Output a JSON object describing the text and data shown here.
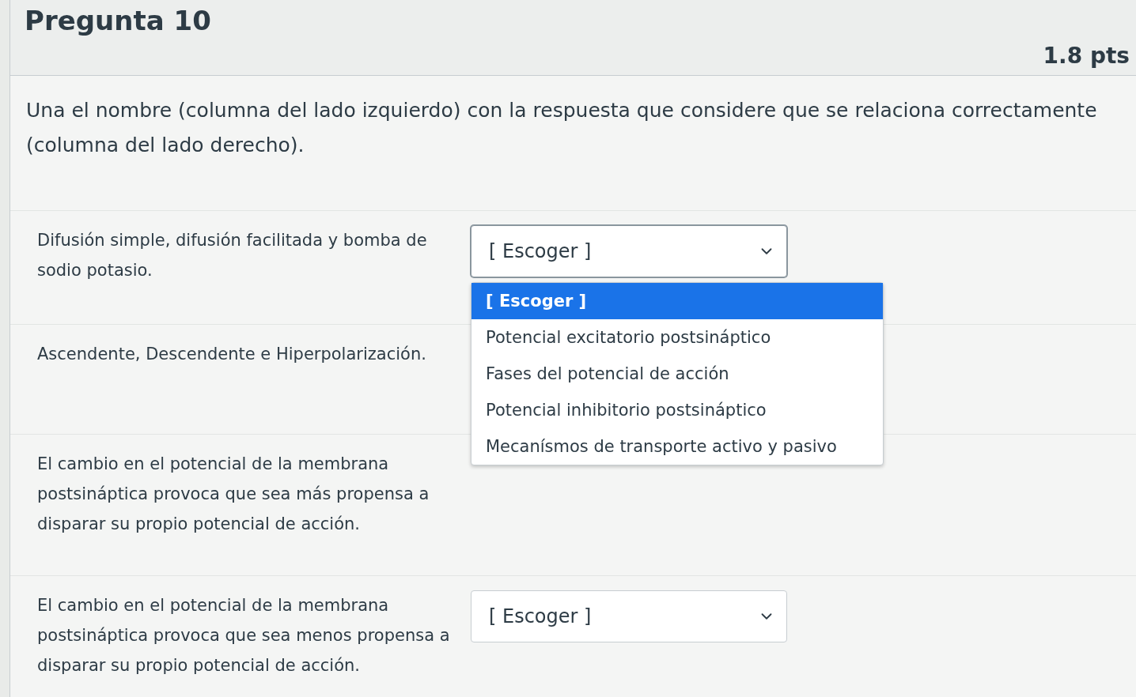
{
  "question": {
    "title": "Pregunta 10",
    "points": "1.8 pts"
  },
  "prompt": "Una el nombre (columna del lado izquierdo) con la respuesta que considere que se relaciona correctamente (columna del lado derecho).",
  "matches": [
    {
      "text": "Difusión simple, difusión facilitada y bomba de sodio potasio.",
      "select": {
        "value": "[ Escoger ]",
        "expanded": true,
        "options": [
          {
            "label": "[ Escoger ]",
            "selected": true
          },
          {
            "label": "Potencial excitatorio postsináptico",
            "selected": false
          },
          {
            "label": "Fases del potencial de acción",
            "selected": false
          },
          {
            "label": "Potencial inhibitorio postsináptico",
            "selected": false
          },
          {
            "label": "Mecanísmos de transporte activo y pasivo",
            "selected": false
          }
        ]
      }
    },
    {
      "text": "Ascendente, Descendente e Hiperpolarización."
    },
    {
      "text": "El cambio en el potencial de la membrana postsináptica provoca que sea más propensa a disparar su propio potencial de acción."
    },
    {
      "text": "El cambio en el potencial de la membrana postsináptica provoca que sea menos propensa a disparar su propio potencial de acción.",
      "select": {
        "value": "[ Escoger ]",
        "expanded": false
      }
    }
  ]
}
